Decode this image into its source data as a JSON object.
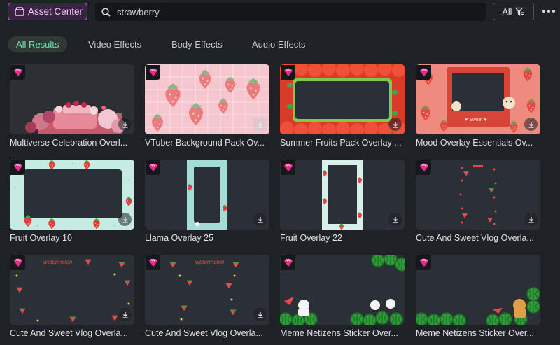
{
  "header": {
    "asset_center_label": "Asset Center",
    "search_value": "strawberry",
    "filter_label": "All",
    "accent_color": "#b86ccc"
  },
  "tabs": [
    {
      "label": "All Results",
      "active": true
    },
    {
      "label": "Video Effects",
      "active": false
    },
    {
      "label": "Body Effects",
      "active": false
    },
    {
      "label": "Audio Effects",
      "active": false
    }
  ],
  "cards": [
    {
      "title": "Multiverse Celebration Overl...",
      "badge": "gem-icon",
      "download": "download-icon"
    },
    {
      "title": "VTuber Background Pack Ov...",
      "badge": "gem-icon",
      "download": "download-icon"
    },
    {
      "title": "Summer Fruits Pack Overlay ...",
      "badge": "gem-icon",
      "download": "download-icon"
    },
    {
      "title": "Mood Overlay Essentials Ov...",
      "badge": "gem-icon",
      "download": "download-icon",
      "thumb_text": "♥ Sweet ♥"
    },
    {
      "title": "Fruit Overlay 10",
      "badge": "gem-icon",
      "download": "download-icon"
    },
    {
      "title": "Llama Overlay 25",
      "badge": "gem-icon",
      "download": "download-icon"
    },
    {
      "title": "Fruit Overlay 22",
      "badge": "gem-icon",
      "download": "download-icon"
    },
    {
      "title": "Cute And Sweet Vlog Overla...",
      "badge": "gem-icon",
      "download": "download-icon"
    },
    {
      "title": "Cute And Sweet Vlog Overla...",
      "badge": "gem-icon",
      "download": "download-icon",
      "thumb_text": "watermelon"
    },
    {
      "title": "Cute And Sweet Vlog Overla...",
      "badge": "gem-icon",
      "download": "download-icon",
      "thumb_text": "watermelon"
    },
    {
      "title": "Meme Netizens Sticker Over...",
      "badge": "gem-icon",
      "download": "download-icon"
    },
    {
      "title": "Meme Netizens Sticker Over...",
      "badge": "gem-icon",
      "download": "download-icon"
    }
  ]
}
